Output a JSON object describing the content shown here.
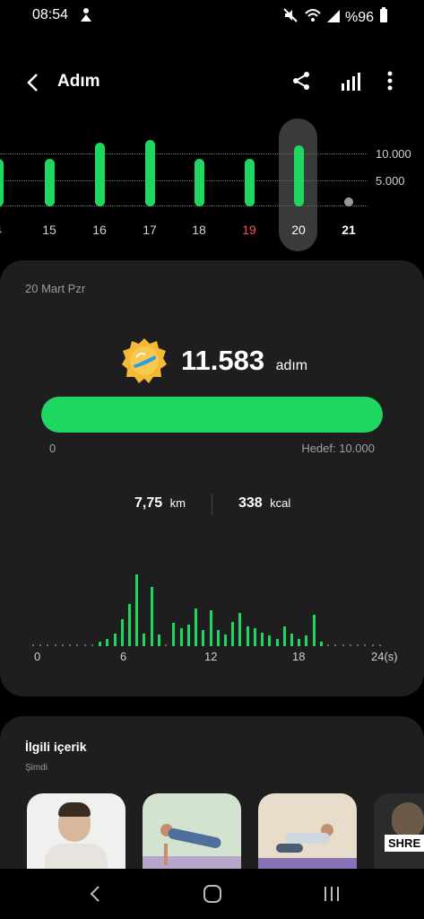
{
  "status": {
    "time": "08:54",
    "battery": "%96"
  },
  "appbar": {
    "title": "Adım"
  },
  "week": {
    "days": [
      "4",
      "15",
      "16",
      "17",
      "18",
      "19",
      "20",
      "21"
    ],
    "day_values": [
      9000,
      9000,
      12000,
      12500,
      9000,
      9000,
      11583,
      0
    ],
    "highlight_day": "19",
    "highlight_color": "#ff4d4d",
    "selected_day": "20",
    "y_labels": [
      "10.000",
      "5.000"
    ],
    "y_label_color": "#1ed760"
  },
  "card": {
    "date": "20 Mart Pzr",
    "steps": "11.583",
    "steps_unit": "adım",
    "progress_start": "0",
    "goal_label": "Hedef: 10.000",
    "progress_fraction": 1.0,
    "distance": "7,75",
    "distance_unit": "km",
    "calories": "338",
    "calories_unit": "kcal",
    "hourly_axis": [
      "0",
      "6",
      "12",
      "18",
      "24(s)"
    ],
    "hourly_values": [
      0,
      0,
      0,
      0,
      0,
      0,
      0,
      0,
      0,
      0.05,
      0.08,
      0.14,
      0.3,
      0.47,
      0.8,
      0.14,
      0.66,
      0.13,
      0.03,
      0.26,
      0.2,
      0.24,
      0.42,
      0.18,
      0.4,
      0.18,
      0.13,
      0.27,
      0.37,
      0.22,
      0.2,
      0.15,
      0.12,
      0.08,
      0.22,
      0.14,
      0.08,
      0.12,
      0.35,
      0.05,
      0.02,
      0,
      0,
      0,
      0,
      0,
      0,
      0
    ],
    "accent": "#1ed760",
    "badge_colors": [
      "#f5b935",
      "#2a9be6"
    ]
  },
  "related": {
    "title": "İlgili içerik",
    "subtitle": "Şimdi",
    "thumb4_text": "SHRE"
  }
}
